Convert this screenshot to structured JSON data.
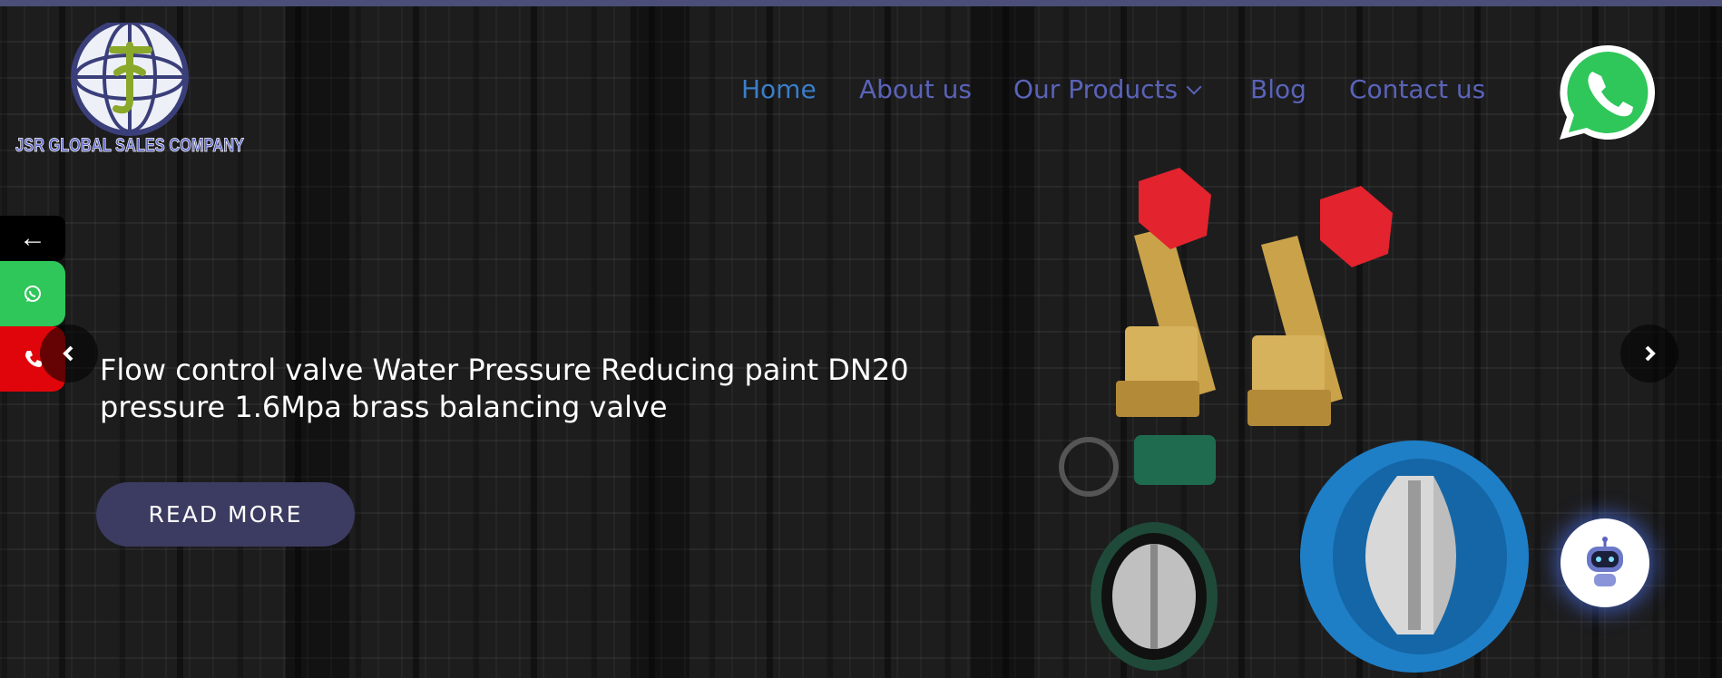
{
  "brand": {
    "logo_text": "JSR GLOBAL SALES COMPANY",
    "accent": "#4a4e78",
    "nav_color": "#5a63b8",
    "nav_active_color": "#3a7ec8"
  },
  "nav": {
    "home": "Home",
    "about": "About us",
    "products": "Our Products",
    "blog": "Blog",
    "contact": "Contact us"
  },
  "side_buttons": {
    "back_glyph": "←",
    "whatsapp_icon": "whatsapp-icon",
    "call_icon": "phone-icon"
  },
  "slider": {
    "heading": "Flow control valve Water Pressure Reducing paint DN20 pressure 1.6Mpa brass balancing valve",
    "button_label": "READ MORE",
    "images": [
      "brass-balancing-valves",
      "butterfly-valve",
      "wafer-check-valve"
    ]
  },
  "floating": {
    "whatsapp_icon": "whatsapp-icon",
    "chatbot_icon": "robot-icon"
  }
}
